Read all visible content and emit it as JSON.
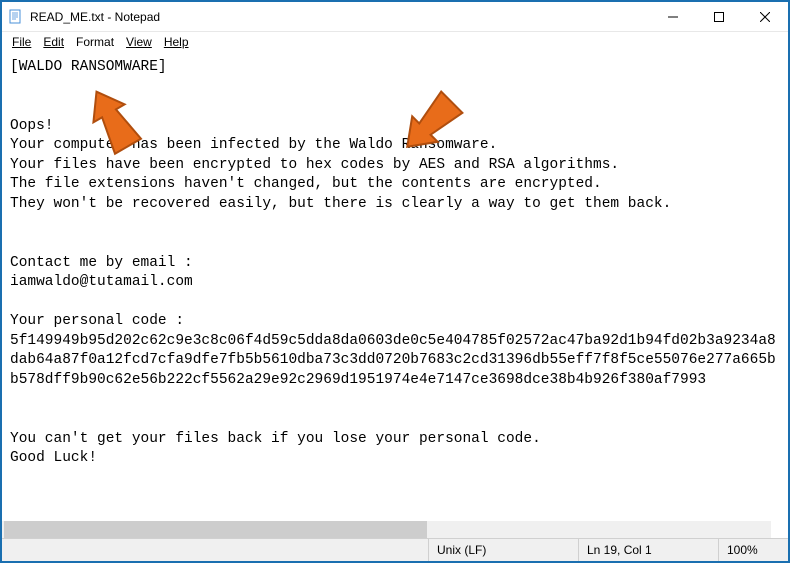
{
  "window": {
    "title": "READ_ME.txt - Notepad"
  },
  "menu": {
    "file": "File",
    "edit": "Edit",
    "format": "Format",
    "view": "View",
    "help": "Help"
  },
  "document": {
    "text": "[WALDO RANSOMWARE]\n\n\nOops!\nYour computer has been infected by the Waldo Ransomware.\nYour files have been encrypted to hex codes by AES and RSA algorithms.\nThe file extensions haven't changed, but the contents are encrypted.\nThey won't be recovered easily, but there is clearly a way to get them back.\n\n\nContact me by email :\niamwaldo@tutamail.com\n\nYour personal code :\n5f149949b95d202c62c9e3c8c06f4d59c5dda8da0603de0c5e404785f02572ac47ba92d1b94fd02b3a9234a8dab64a87f0a12fcd7cfa9dfe7fb5b5610dba73c3dd0720b7683c2cd31396db55eff7f8f5ce55076e277a665bb578dff9b90c62e56b222cf5562a29e92c2969d1951974e4e7147ce3698dce38b4b926f380af7993\n\n\nYou can't get your files back if you lose your personal code.\nGood Luck!"
  },
  "statusbar": {
    "encoding": "Unix (LF)",
    "position": "Ln 19, Col 1",
    "zoom": "100%"
  },
  "annotations": {
    "arrow1_target": "WALDO RANSOMWARE header",
    "arrow2_target": "Waldo Ransomware text"
  }
}
